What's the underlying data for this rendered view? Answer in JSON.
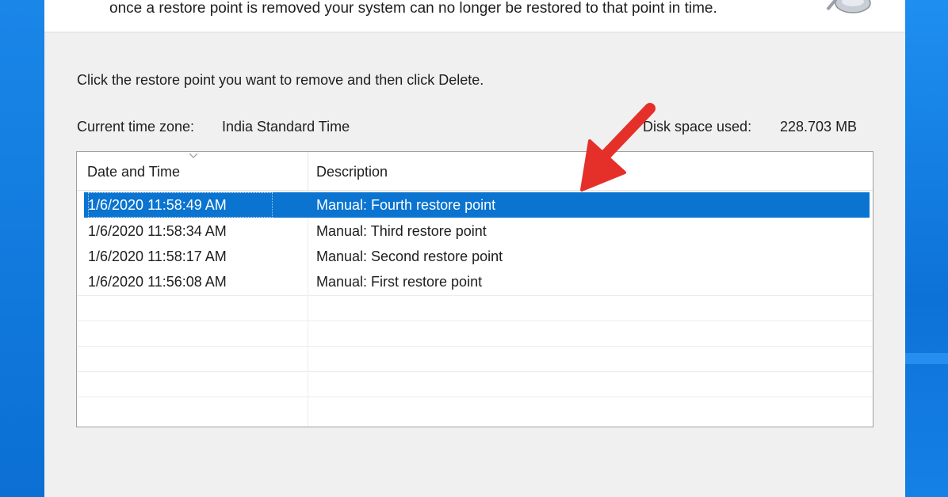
{
  "dialog": {
    "header_text": "once a restore point is removed your system can no longer be restored to that point in time.",
    "header_icon": "system-restore-icon",
    "instruction": "Click the restore point you want to remove and then click Delete.",
    "timezone_label": "Current time zone:",
    "timezone_value": "India Standard Time",
    "disk_label": "Disk space used:",
    "disk_value": "228.703 MB"
  },
  "table": {
    "columns": [
      "Date and Time",
      "Description"
    ],
    "sort_indicator_icon": "sort-caret-icon",
    "rows": [
      {
        "date": "1/6/2020 11:58:49 AM",
        "description": "Manual: Fourth restore point",
        "selected": true
      },
      {
        "date": "1/6/2020 11:58:34 AM",
        "description": "Manual: Third restore point",
        "selected": false
      },
      {
        "date": "1/6/2020 11:58:17 AM",
        "description": "Manual: Second restore point",
        "selected": false
      },
      {
        "date": "1/6/2020 11:56:08 AM",
        "description": "Manual: First restore point",
        "selected": false
      }
    ]
  },
  "annotation": {
    "arrow_icon": "red-arrow-icon",
    "arrow_color": "#e5302a"
  },
  "colors": {
    "selection": "#0a74d0",
    "desktop": "#0a72d6",
    "dialog_bg": "#f0f0f0"
  }
}
